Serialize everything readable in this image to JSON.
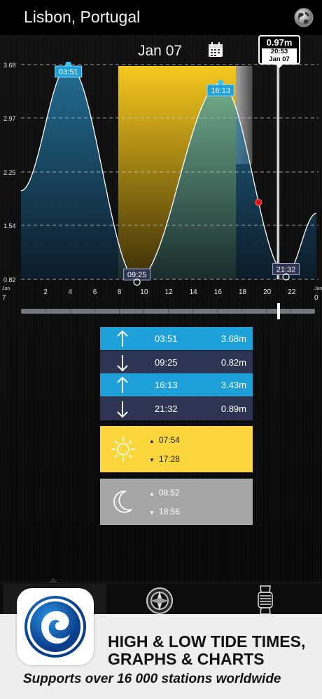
{
  "header": {
    "location": "Lisbon, Portugal",
    "date": "Jan 07"
  },
  "cursor_callout": {
    "height": "0.97m",
    "time": "20:53",
    "date": "Jan 07"
  },
  "chart_data": {
    "type": "line",
    "y_ticks": [
      "3.68",
      "2.97",
      "2.25",
      "1.54",
      "0.82"
    ],
    "ylim": [
      0.82,
      3.68
    ],
    "x_ticks": [
      "2",
      "4",
      "6",
      "8",
      "10",
      "12",
      "14",
      "16",
      "18",
      "20",
      "22"
    ],
    "x_edge_left": {
      "top": "Jan",
      "bottom": "7"
    },
    "x_edge_right": {
      "top": "Jan",
      "bottom": "0"
    },
    "xlim": [
      0,
      24
    ],
    "series": [
      {
        "x": [
          0,
          3.85,
          9.42,
          16.22,
          21.53,
          24
        ],
        "y": [
          2.0,
          3.68,
          0.82,
          3.43,
          0.89,
          1.7
        ]
      }
    ],
    "extreme_labels": [
      "03:51",
      "09:25",
      "16:13",
      "21:32"
    ],
    "daylight": [
      7.9,
      17.47
    ],
    "now_marker_x": 19.3,
    "cursor_x": 20.88
  },
  "tides": [
    {
      "type": "high",
      "time": "03:51",
      "height": "3.68m"
    },
    {
      "type": "low",
      "time": "09:25",
      "height": "0.82m"
    },
    {
      "type": "high",
      "time": "16:13",
      "height": "3.43m"
    },
    {
      "type": "low",
      "time": "21:32",
      "height": "0.89m"
    }
  ],
  "sun": {
    "rise": "07:54",
    "set": "17:28",
    "icon": "sun-icon"
  },
  "moon": {
    "rise": "08:52",
    "set": "18:56",
    "icon": "moon-icon"
  },
  "tabbar": {
    "items": [
      "tides-tab",
      "compass-tab",
      "watch-tab"
    ]
  },
  "banner": {
    "headline_line1": "HIGH & LOW TIDE TIMES,",
    "headline_line2": "GRAPHS & CHARTS",
    "subline": "Supports over 16 000 stations worldwide"
  },
  "colors": {
    "high": "#1da1d8",
    "low": "#2d3552",
    "sun": "#fbd63c",
    "moon": "#a6a6a8",
    "now": "#e01010"
  }
}
